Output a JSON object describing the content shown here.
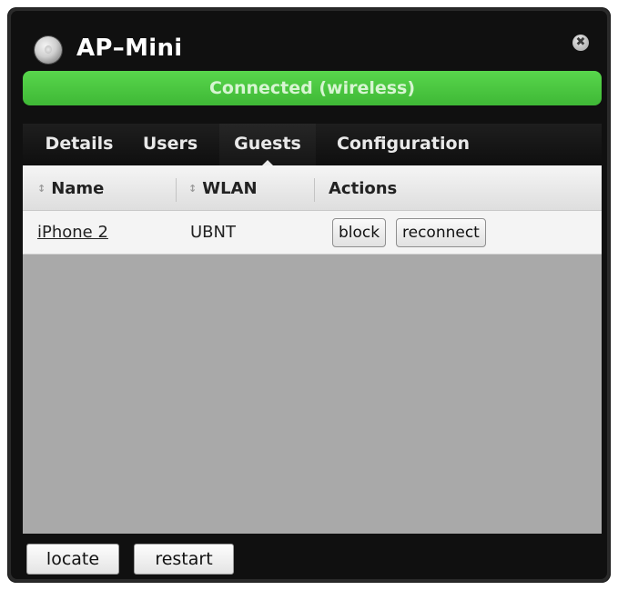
{
  "window": {
    "title": "AP–Mini",
    "close_glyph": "✖",
    "status": "Connected (wireless)",
    "status_color": "#4cc842"
  },
  "tabs": [
    {
      "label": "Details",
      "active": false
    },
    {
      "label": "Users",
      "active": false
    },
    {
      "label": "Guests",
      "active": true
    },
    {
      "label": "Configuration",
      "active": false
    }
  ],
  "table": {
    "columns": [
      {
        "label": "Name",
        "sortable": true,
        "sort_icon": "↕"
      },
      {
        "label": "WLAN",
        "sortable": true,
        "sort_icon": "↕"
      },
      {
        "label": "Actions",
        "sortable": false
      }
    ],
    "rows": [
      {
        "name": "iPhone 2",
        "wlan": "UBNT",
        "actions": [
          "block",
          "reconnect"
        ]
      }
    ]
  },
  "footer": {
    "locate_label": "locate",
    "restart_label": "restart"
  }
}
